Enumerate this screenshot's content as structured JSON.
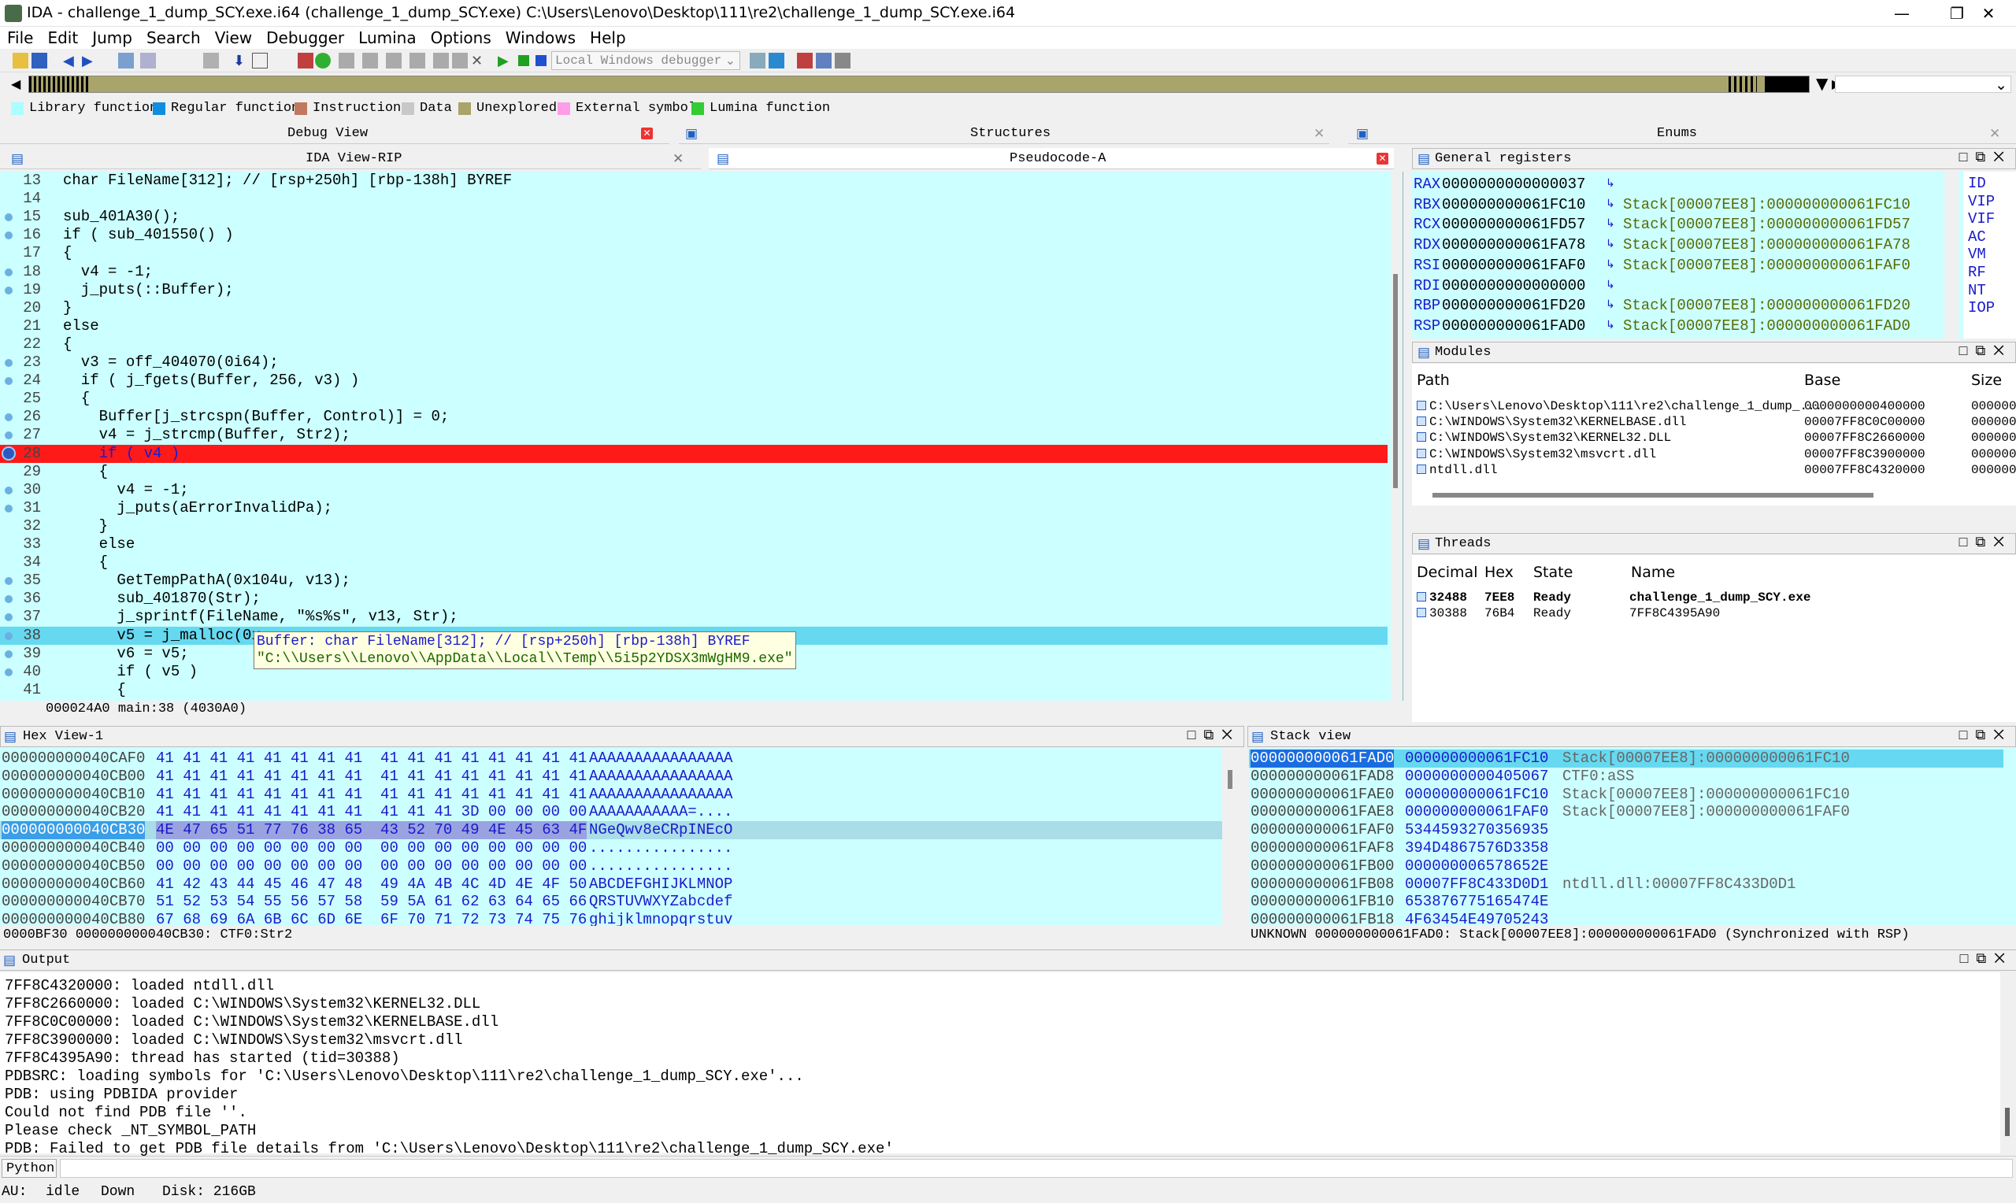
{
  "window": {
    "title": "IDA - challenge_1_dump_SCY.exe.i64 (challenge_1_dump_SCY.exe) C:\\Users\\Lenovo\\Desktop\\111\\re2\\challenge_1_dump_SCY.exe.i64",
    "minimize": "—",
    "maximize": "❐",
    "close": "✕"
  },
  "menu": [
    "File",
    "Edit",
    "Jump",
    "Search",
    "View",
    "Debugger",
    "Lumina",
    "Options",
    "Windows",
    "Help"
  ],
  "toolbar": {
    "debugger_select": "Local Windows debugger"
  },
  "legend": [
    {
      "label": "Library function",
      "color": "#aaffff"
    },
    {
      "label": "Regular function",
      "color": "#0f8ee0"
    },
    {
      "label": "Instruction",
      "color": "#c07860"
    },
    {
      "label": "Data",
      "color": "#c8c8c8"
    },
    {
      "label": "Unexplored",
      "color": "#a9a46a"
    },
    {
      "label": "External symbol",
      "color": "#ff9ee8"
    },
    {
      "label": "Lumina function",
      "color": "#33cc33"
    }
  ],
  "tabs": {
    "debug_view": "Debug View",
    "structures": "Structures",
    "enums": "Enums",
    "ida_view": "IDA View-RIP",
    "pseudocode": "Pseudocode-A"
  },
  "pseudocode": {
    "lines": [
      {
        "n": "13",
        "t": "char FileName[312]; // [rsp+250h] [rbp-138h] BYREF",
        "dot": false
      },
      {
        "n": "14",
        "t": "",
        "dot": false
      },
      {
        "n": "15",
        "t": "sub_401A30();",
        "dot": true
      },
      {
        "n": "16",
        "t": "if ( sub_401550() )",
        "dot": true
      },
      {
        "n": "17",
        "t": "{",
        "dot": false
      },
      {
        "n": "18",
        "t": "  v4 = -1;",
        "dot": true
      },
      {
        "n": "19",
        "t": "  j_puts(::Buffer);",
        "dot": true
      },
      {
        "n": "20",
        "t": "}",
        "dot": false
      },
      {
        "n": "21",
        "t": "else",
        "dot": false
      },
      {
        "n": "22",
        "t": "{",
        "dot": false
      },
      {
        "n": "23",
        "t": "  v3 = off_404070(0i64);",
        "dot": true
      },
      {
        "n": "24",
        "t": "  if ( j_fgets(Buffer, 256, v3) )",
        "dot": true
      },
      {
        "n": "25",
        "t": "  {",
        "dot": false
      },
      {
        "n": "26",
        "t": "    Buffer[j_strcspn(Buffer, Control)] = 0;",
        "dot": true
      },
      {
        "n": "27",
        "t": "    v4 = j_strcmp(Buffer, Str2);",
        "dot": true
      },
      {
        "n": "28",
        "t": "    if ( v4 )",
        "dot": true
      },
      {
        "n": "29",
        "t": "    {",
        "dot": false
      },
      {
        "n": "30",
        "t": "      v4 = -1;",
        "dot": true
      },
      {
        "n": "31",
        "t": "      j_puts(aErrorInvalidPa);",
        "dot": true
      },
      {
        "n": "32",
        "t": "    }",
        "dot": false
      },
      {
        "n": "33",
        "t": "    else",
        "dot": false
      },
      {
        "n": "34",
        "t": "    {",
        "dot": false
      },
      {
        "n": "35",
        "t": "      GetTempPathA(0x104u, v13);",
        "dot": true
      },
      {
        "n": "36",
        "t": "      sub_401870(Str);",
        "dot": true
      },
      {
        "n": "37",
        "t": "      j_sprintf(FileName, \"%s%s\", v13, Str);",
        "dot": true
      },
      {
        "n": "38",
        "t": "      v5 = j_malloc(0x",
        "dot": true
      },
      {
        "n": "39",
        "t": "      v6 = v5;",
        "dot": true
      },
      {
        "n": "40",
        "t": "      if ( v5 )",
        "dot": true
      },
      {
        "n": "41",
        "t": "      {",
        "dot": false
      }
    ],
    "status": "000024A0 main:38 (4030A0)",
    "tooltip_line1": "Buffer: char FileName[312]; // [rsp+250h] [rbp-138h] BYREF",
    "tooltip_line2": "\"C:\\\\Users\\\\Lenovo\\\\AppData\\\\Local\\\\Temp\\\\5i5p2YDSX3mWgHM9.exe\""
  },
  "registers": {
    "title": "General registers",
    "rows": [
      {
        "r": "RAX",
        "v": "0000000000000037",
        "c": ""
      },
      {
        "r": "RBX",
        "v": "000000000061FC10",
        "c": "Stack[00007EE8]:000000000061FC10"
      },
      {
        "r": "RCX",
        "v": "000000000061FD57",
        "c": "Stack[00007EE8]:000000000061FD57"
      },
      {
        "r": "RDX",
        "v": "000000000061FA78",
        "c": "Stack[00007EE8]:000000000061FA78"
      },
      {
        "r": "RSI",
        "v": "000000000061FAF0",
        "c": "Stack[00007EE8]:000000000061FAF0"
      },
      {
        "r": "RDI",
        "v": "0000000000000000",
        "c": ""
      },
      {
        "r": "RBP",
        "v": "000000000061FD20",
        "c": "Stack[00007EE8]:000000000061FD20"
      },
      {
        "r": "RSP",
        "v": "000000000061FAD0",
        "c": "Stack[00007EE8]:000000000061FAD0"
      }
    ],
    "flags": [
      "ID",
      "VIP",
      "VIF",
      "AC",
      "VM",
      "RF",
      "NT",
      "IOP"
    ]
  },
  "modules": {
    "title": "Modules",
    "cols": [
      "Path",
      "Base",
      "Size"
    ],
    "rows": [
      {
        "p": "C:\\Users\\Lenovo\\Desktop\\111\\re2\\challenge_1_dump_...",
        "b": "0000000000400000",
        "s": "0000000"
      },
      {
        "p": "C:\\WINDOWS\\System32\\KERNELBASE.dll",
        "b": "00007FF8C0C00000",
        "s": "0000000"
      },
      {
        "p": "C:\\WINDOWS\\System32\\KERNEL32.DLL",
        "b": "00007FF8C2660000",
        "s": "0000000"
      },
      {
        "p": "C:\\WINDOWS\\System32\\msvcrt.dll",
        "b": "00007FF8C3900000",
        "s": "0000000"
      },
      {
        "p": "ntdll.dll",
        "b": "00007FF8C4320000",
        "s": "0000000"
      }
    ]
  },
  "threads": {
    "title": "Threads",
    "cols": [
      "Decimal",
      "Hex",
      "State",
      "Name"
    ],
    "rows": [
      {
        "d": "32488",
        "h": "7EE8",
        "s": "Ready",
        "n": "challenge_1_dump_SCY.exe"
      },
      {
        "d": "30388",
        "h": "76B4",
        "s": "Ready",
        "n": "7FF8C4395A90"
      }
    ]
  },
  "hexview": {
    "title": "Hex View-1",
    "rows": [
      {
        "a": "000000000040CAF0",
        "b": "41 41 41 41 41 41 41 41  41 41 41 41 41 41 41 41",
        "s": "AAAAAAAAAAAAAAAA"
      },
      {
        "a": "000000000040CB00",
        "b": "41 41 41 41 41 41 41 41  41 41 41 41 41 41 41 41",
        "s": "AAAAAAAAAAAAAAAA"
      },
      {
        "a": "000000000040CB10",
        "b": "41 41 41 41 41 41 41 41  41 41 41 41 41 41 41 41",
        "s": "AAAAAAAAAAAAAAAA"
      },
      {
        "a": "000000000040CB20",
        "b": "41 41 41 41 41 41 41 41  41 41 41 3D 00 00 00 00",
        "s": "AAAAAAAAAAA=...."
      },
      {
        "a": "000000000040CB30",
        "b": "4E 47 65 51 77 76 38 65  43 52 70 49 4E 45 63 4F",
        "s": "NGeQwv8eCRpINEcO"
      },
      {
        "a": "000000000040CB40",
        "b": "00 00 00 00 00 00 00 00  00 00 00 00 00 00 00 00",
        "s": "................"
      },
      {
        "a": "000000000040CB50",
        "b": "00 00 00 00 00 00 00 00  00 00 00 00 00 00 00 00",
        "s": "................"
      },
      {
        "a": "000000000040CB60",
        "b": "41 42 43 44 45 46 47 48  49 4A 4B 4C 4D 4E 4F 50",
        "s": "ABCDEFGHIJKLMNOP"
      },
      {
        "a": "000000000040CB70",
        "b": "51 52 53 54 55 56 57 58  59 5A 61 62 63 64 65 66",
        "s": "QRSTUVWXYZabcdef"
      },
      {
        "a": "000000000040CB80",
        "b": "67 68 69 6A 6B 6C 6D 6E  6F 70 71 72 73 74 75 76",
        "s": "ghijklmnopqrstuv"
      }
    ],
    "status": "0000BF30 000000000040CB30: CTF0:Str2"
  },
  "stackview": {
    "title": "Stack view",
    "rows": [
      {
        "a": "000000000061FAD0",
        "v": "000000000061FC10",
        "c": "Stack[00007EE8]:000000000061FC10"
      },
      {
        "a": "000000000061FAD8",
        "v": "0000000000405067",
        "c": "CTF0:aSS"
      },
      {
        "a": "000000000061FAE0",
        "v": "000000000061FC10",
        "c": "Stack[00007EE8]:000000000061FC10"
      },
      {
        "a": "000000000061FAE8",
        "v": "000000000061FAF0",
        "c": "Stack[00007EE8]:000000000061FAF0"
      },
      {
        "a": "000000000061FAF0",
        "v": "5344593270356935",
        "c": ""
      },
      {
        "a": "000000000061FAF8",
        "v": "394D4867576D3358",
        "c": ""
      },
      {
        "a": "000000000061FB00",
        "v": "000000006578652E",
        "c": ""
      },
      {
        "a": "000000000061FB08",
        "v": "00007FF8C433D0D1",
        "c": "ntdll.dll:00007FF8C433D0D1"
      },
      {
        "a": "000000000061FB10",
        "v": "653876775165474E",
        "c": ""
      },
      {
        "a": "000000000061FB18",
        "v": "4F63454E49705243",
        "c": ""
      }
    ],
    "status": "UNKNOWN 000000000061FAD0: Stack[00007EE8]:000000000061FAD0 (Synchronized with RSP)"
  },
  "output": {
    "title": "Output",
    "lines": [
      "7FF8C4320000: loaded ntdll.dll",
      "7FF8C2660000: loaded C:\\WINDOWS\\System32\\KERNEL32.DLL",
      "7FF8C0C00000: loaded C:\\WINDOWS\\System32\\KERNELBASE.dll",
      "7FF8C3900000: loaded C:\\WINDOWS\\System32\\msvcrt.dll",
      "7FF8C4395A90: thread has started (tid=30388)",
      "PDBSRC: loading symbols for 'C:\\Users\\Lenovo\\Desktop\\111\\re2\\challenge_1_dump_SCY.exe'...",
      "PDB: using PDBIDA provider",
      "Could not find PDB file ''.",
      "Please check _NT_SYMBOL_PATH",
      "PDB: Failed to get PDB file details from 'C:\\Users\\Lenovo\\Desktop\\111\\re2\\challenge_1_dump_SCY.exe'"
    ],
    "python_btn": "Python"
  },
  "status": {
    "au": "AU:",
    "state": "idle",
    "dir": "Down",
    "disk": "Disk: 216GB"
  }
}
